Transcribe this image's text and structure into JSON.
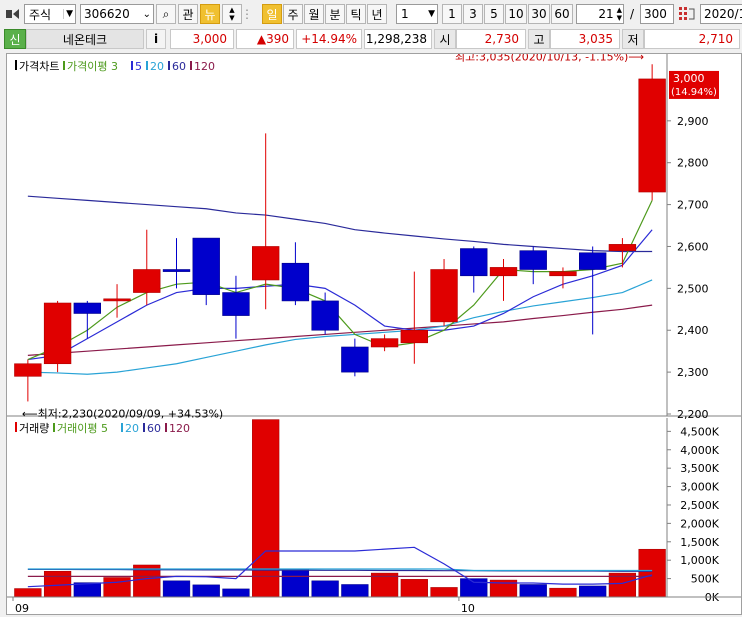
{
  "toolbar": {
    "market": "주식",
    "code": "306620",
    "btn_gwan": "관",
    "btn_new": "뉴",
    "periods": [
      "일",
      "주",
      "월",
      "분",
      "틱",
      "년"
    ],
    "count_select": "1",
    "quick_counts": [
      "1",
      "3",
      "5",
      "10",
      "30",
      "60"
    ],
    "view_count": "21",
    "total_count": "300",
    "date": "2020/1"
  },
  "info": {
    "badge": "신",
    "name": "네온테크",
    "info_btn": "i",
    "price": "3,000",
    "change": "▲390",
    "change_pct": "+14.94%",
    "volume": "1,298,238",
    "open_label": "시",
    "open": "2,730",
    "high_label": "고",
    "high": "3,035",
    "low_label": "저",
    "low": "2,710"
  },
  "price_legend": [
    {
      "text": "가격차트",
      "color": "#000000"
    },
    {
      "text": "가격이평 3",
      "color": "#4d9a1c"
    },
    {
      "text": "5",
      "color": "#2b2bd6"
    },
    {
      "text": "20",
      "color": "#29a3d6"
    },
    {
      "text": "60",
      "color": "#2a2a9a"
    },
    {
      "text": "120",
      "color": "#8a1a4a"
    }
  ],
  "volume_legend": [
    {
      "text": "거래량",
      "color": "#000000"
    },
    {
      "text": "거래이평 5",
      "color": "#4d9a1c"
    },
    {
      "text": "20",
      "color": "#29a3d6"
    },
    {
      "text": "60",
      "color": "#2a2a9a"
    },
    {
      "text": "120",
      "color": "#8a1a4a"
    }
  ],
  "annotations": {
    "high": "최고:3,035(2020/10/13, -1.15%)",
    "low": "최저:2,230(2020/09/09, +34.53%)",
    "last_price": "3,000",
    "last_pct": "(14.94%)"
  },
  "colors": {
    "up": "#e00000",
    "down": "#0000cc",
    "ma3": "#4d9a1c",
    "ma5": "#2b2bd6",
    "ma20": "#29a3d6",
    "ma60": "#2a2a9a",
    "ma120": "#8a1a4a"
  },
  "chart_data": [
    {
      "type": "candlestick",
      "title": "가격차트",
      "ylim": [
        2200,
        3050
      ],
      "yticks": [
        2200,
        2300,
        2400,
        2500,
        2600,
        2700,
        2800,
        2900
      ],
      "x_labels": [
        {
          "label": "09",
          "index": 0
        },
        {
          "label": "10",
          "index": 15
        }
      ],
      "candles": [
        {
          "o": 2290,
          "h": 2330,
          "l": 2230,
          "c": 2320
        },
        {
          "o": 2320,
          "h": 2470,
          "l": 2300,
          "c": 2465
        },
        {
          "o": 2465,
          "h": 2470,
          "l": 2380,
          "c": 2440
        },
        {
          "o": 2470,
          "h": 2510,
          "l": 2430,
          "c": 2475
        },
        {
          "o": 2490,
          "h": 2640,
          "l": 2460,
          "c": 2545
        },
        {
          "o": 2545,
          "h": 2620,
          "l": 2500,
          "c": 2540
        },
        {
          "o": 2620,
          "h": 2620,
          "l": 2460,
          "c": 2485
        },
        {
          "o": 2490,
          "h": 2530,
          "l": 2380,
          "c": 2435
        },
        {
          "o": 2520,
          "h": 2870,
          "l": 2450,
          "c": 2600
        },
        {
          "o": 2560,
          "h": 2610,
          "l": 2460,
          "c": 2470
        },
        {
          "o": 2470,
          "h": 2490,
          "l": 2390,
          "c": 2400
        },
        {
          "o": 2360,
          "h": 2380,
          "l": 2290,
          "c": 2300
        },
        {
          "o": 2360,
          "h": 2390,
          "l": 2350,
          "c": 2380
        },
        {
          "o": 2370,
          "h": 2540,
          "l": 2320,
          "c": 2400
        },
        {
          "o": 2420,
          "h": 2570,
          "l": 2410,
          "c": 2545
        },
        {
          "o": 2595,
          "h": 2600,
          "l": 2490,
          "c": 2530
        },
        {
          "o": 2530,
          "h": 2570,
          "l": 2470,
          "c": 2550
        },
        {
          "o": 2590,
          "h": 2600,
          "l": 2510,
          "c": 2545
        },
        {
          "o": 2530,
          "h": 2550,
          "l": 2500,
          "c": 2540
        },
        {
          "o": 2585,
          "h": 2600,
          "l": 2390,
          "c": 2545
        },
        {
          "o": 2590,
          "h": 2620,
          "l": 2550,
          "c": 2605
        },
        {
          "o": 2730,
          "h": 3035,
          "l": 2710,
          "c": 3000
        }
      ],
      "ma3": [
        2330,
        2360,
        2400,
        2455,
        2490,
        2510,
        2515,
        2490,
        2510,
        2500,
        2470,
        2390,
        2360,
        2370,
        2400,
        2460,
        2545,
        2540,
        2540,
        2545,
        2560,
        2710
      ],
      "ma5": [
        2330,
        2340,
        2380,
        2420,
        2460,
        2490,
        2500,
        2500,
        2505,
        2510,
        2500,
        2460,
        2410,
        2400,
        2400,
        2410,
        2440,
        2480,
        2510,
        2530,
        2555,
        2640
      ],
      "ma20": [
        2300,
        2298,
        2295,
        2300,
        2310,
        2320,
        2335,
        2350,
        2365,
        2378,
        2385,
        2390,
        2395,
        2400,
        2410,
        2430,
        2445,
        2458,
        2468,
        2478,
        2490,
        2520
      ],
      "ma60": [
        2720,
        2715,
        2710,
        2705,
        2700,
        2695,
        2690,
        2680,
        2675,
        2665,
        2655,
        2640,
        2632,
        2625,
        2618,
        2612,
        2605,
        2600,
        2595,
        2590,
        2588,
        2588
      ],
      "ma120": [
        2340,
        2345,
        2350,
        2355,
        2360,
        2365,
        2370,
        2375,
        2380,
        2385,
        2390,
        2395,
        2400,
        2405,
        2410,
        2415,
        2420,
        2428,
        2435,
        2443,
        2450,
        2460
      ]
    },
    {
      "type": "bar",
      "title": "거래량",
      "ylim": [
        0,
        4700000
      ],
      "yticks": [
        0,
        500000,
        1000000,
        1500000,
        2000000,
        2500000,
        3000000,
        3500000,
        4000000,
        4500000
      ],
      "ytick_labels": [
        "0K",
        "500K",
        "1,000K",
        "1,500K",
        "2,000K",
        "2,500K",
        "3,000K",
        "3,500K",
        "4,000K",
        "4,500K"
      ],
      "volumes": [
        230000,
        700000,
        390000,
        530000,
        870000,
        440000,
        330000,
        220000,
        4820000,
        750000,
        440000,
        340000,
        650000,
        480000,
        260000,
        500000,
        460000,
        340000,
        240000,
        300000,
        650000,
        1298238
      ],
      "ma5": [
        280000,
        320000,
        360000,
        400000,
        500000,
        560000,
        550000,
        500000,
        1250000,
        1250000,
        1250000,
        1250000,
        1300000,
        1350000,
        900000,
        400000,
        380000,
        380000,
        350000,
        350000,
        370000,
        600000
      ],
      "ma20": [
        760000,
        760000,
        760000,
        760000,
        760000,
        760000,
        760000,
        760000,
        760000,
        760000,
        760000,
        760000,
        760000,
        760000,
        760000,
        720000,
        720000,
        720000,
        720000,
        720000,
        720000,
        720000
      ],
      "ma60": [
        750000,
        750000,
        745000,
        745000,
        740000,
        740000,
        735000,
        735000,
        730000,
        730000,
        725000,
        725000,
        720000,
        720000,
        715000,
        715000,
        710000,
        710000,
        705000,
        705000,
        700000,
        700000
      ],
      "ma120": [
        560000,
        560000,
        560000,
        560000,
        560000,
        560000,
        560000,
        560000,
        560000,
        560000,
        560000,
        560000,
        560000,
        560000,
        560000,
        560000,
        560000,
        560000,
        560000,
        560000,
        560000,
        560000
      ]
    }
  ]
}
